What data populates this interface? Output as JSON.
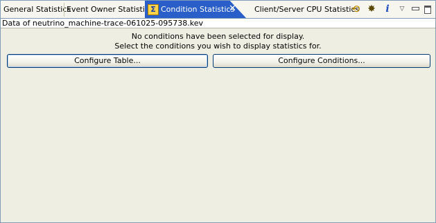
{
  "tabs": [
    {
      "label": "General Statistics",
      "active": false
    },
    {
      "label": "Event Owner Statistics",
      "active": false
    },
    {
      "label": "Condition Statistics",
      "active": true,
      "icon": "sigma-icon",
      "icon_glyph": "Σ",
      "close_glyph": "✕"
    },
    {
      "label": "Client/Server CPU Statistics",
      "active": false
    }
  ],
  "toolbar": {
    "pin_glyph": "⟲",
    "filter_glyph": "✸",
    "info_glyph": "i",
    "menu_glyph": "▽"
  },
  "file_label": "Data of neutrino_machine-trace-061025-095738.kev",
  "message": {
    "line1": "No conditions have been selected for display.",
    "line2": "Select the conditions you wish to display statistics for."
  },
  "buttons": {
    "configure_table": "Configure Table...",
    "configure_conditions": "Configure Conditions..."
  },
  "colors": {
    "active_tab": "#2a5fc9",
    "background": "#efeee2",
    "border": "#7f9db9"
  }
}
